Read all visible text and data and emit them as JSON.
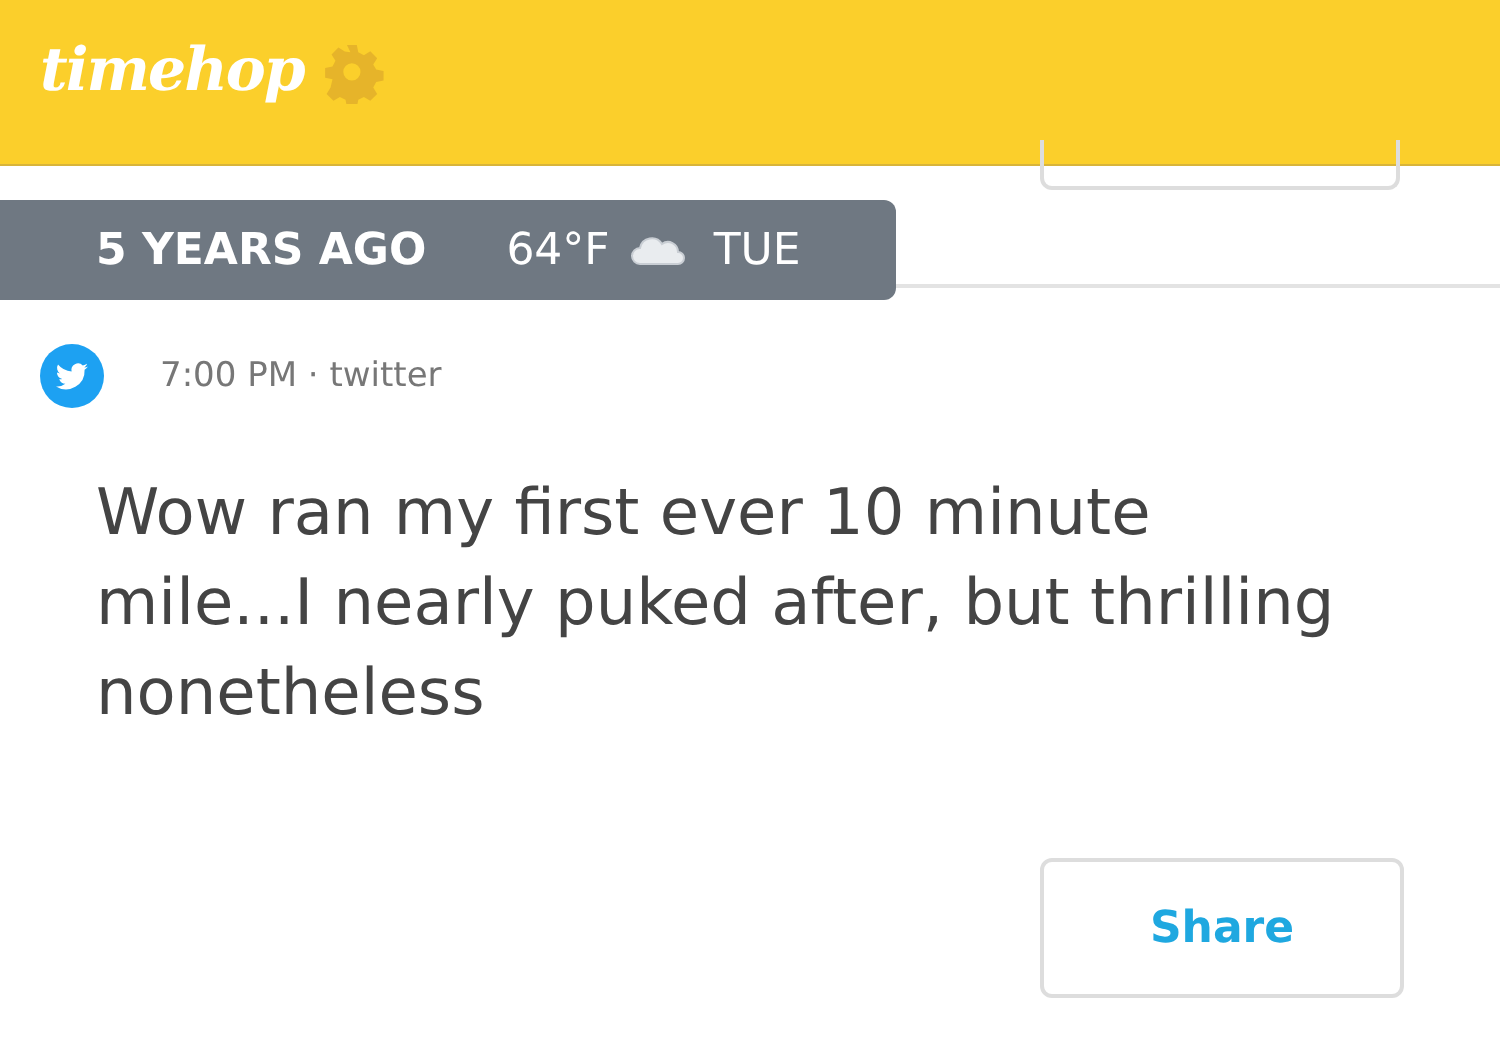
{
  "header": {
    "logo": "timehop"
  },
  "date_tab": {
    "label": "5 YEARS AGO",
    "temperature": "64°F",
    "weekday": "TUE"
  },
  "post": {
    "time_source": "7:00 PM · twitter",
    "text": "Wow ran my first ever 10 minute mile...I nearly puked after, but thrilling nonetheless",
    "button": "Share"
  }
}
